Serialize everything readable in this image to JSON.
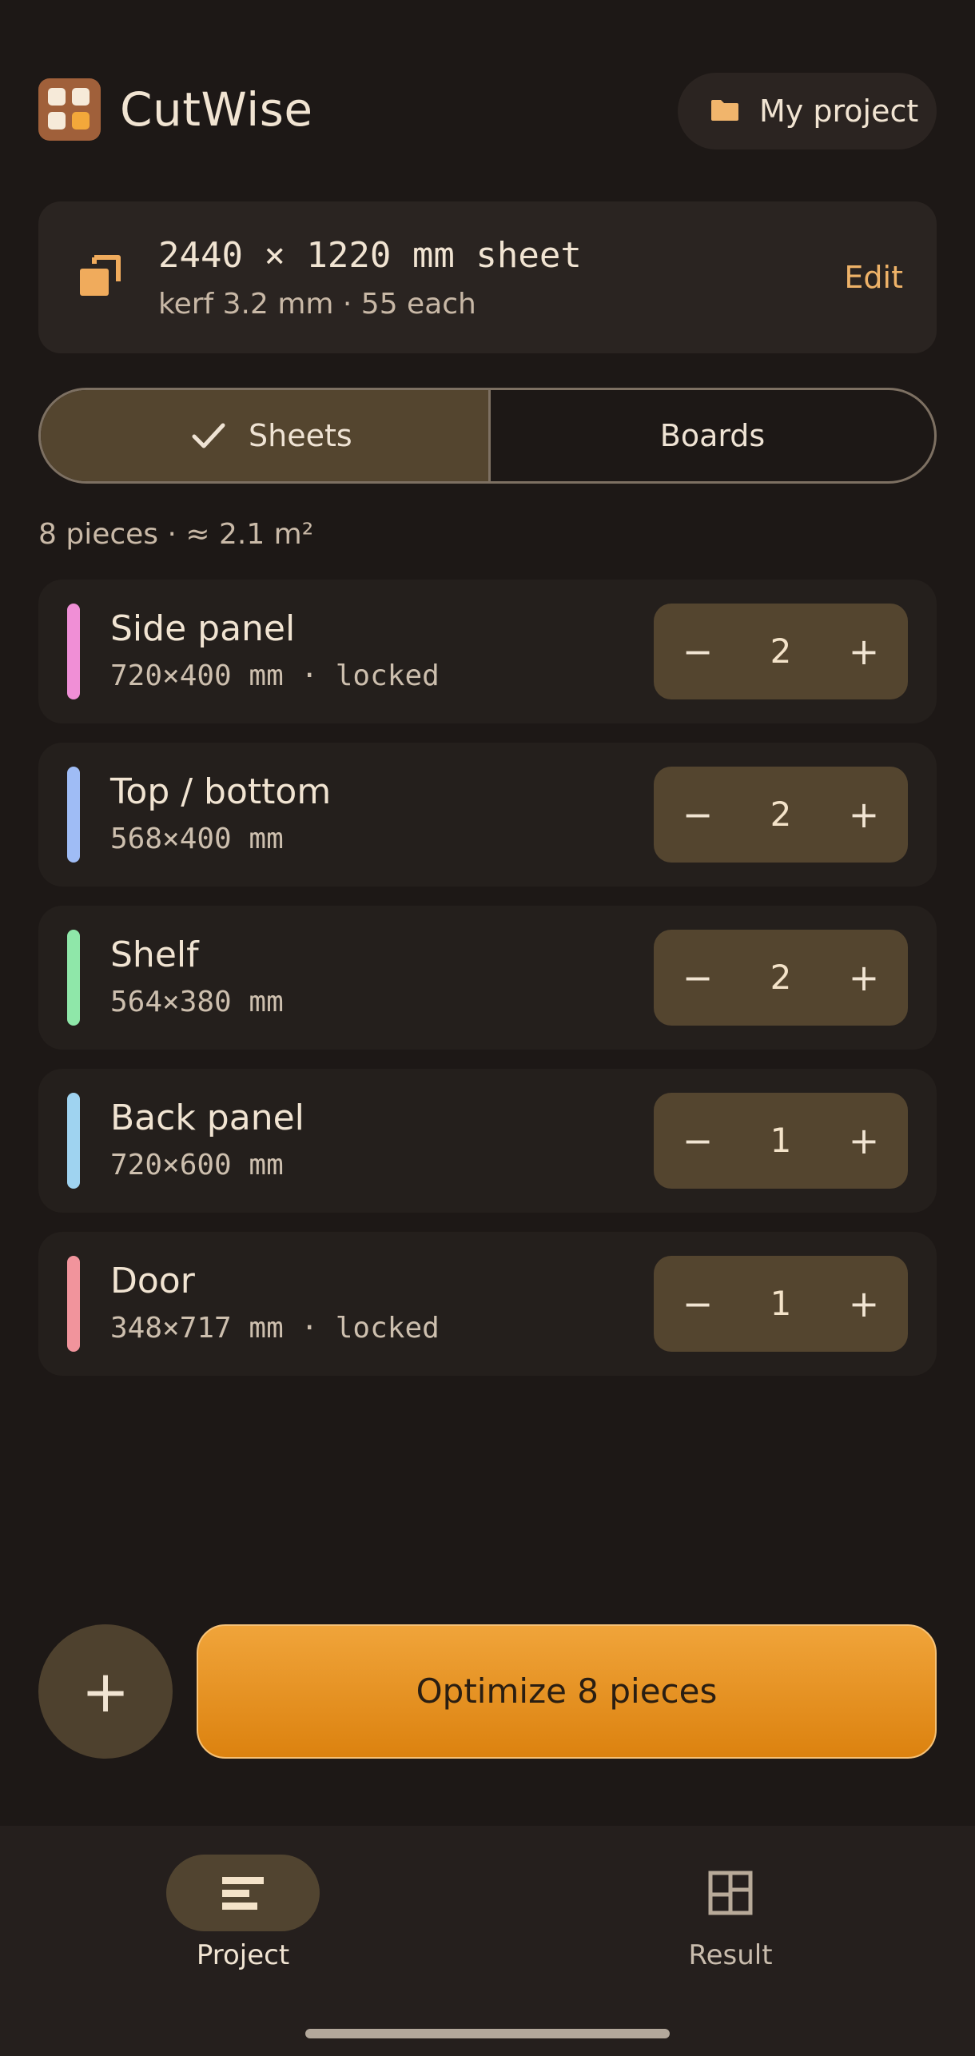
{
  "app": {
    "title": "CutWise",
    "project_button": "My project",
    "accent": "#f0a43a"
  },
  "sheet": {
    "title": "2440 × 1220 mm sheet",
    "subtitle": "kerf 3.2 mm  ·  55 each",
    "edit": "Edit",
    "icon": "copy-icon"
  },
  "mode": {
    "sheets": "Sheets",
    "boards": "Boards",
    "selected": "Sheets"
  },
  "summary": "8 pieces · ≈ 2.1 m²",
  "pieces": [
    {
      "name": "Side panel",
      "dims": "720×400 mm · locked",
      "qty": "2",
      "color": "#f08fd6"
    },
    {
      "name": "Top / bottom",
      "dims": "568×400 mm",
      "qty": "2",
      "color": "#9fbcf5"
    },
    {
      "name": "Shelf",
      "dims": "564×380 mm",
      "qty": "2",
      "color": "#8fe7a9"
    },
    {
      "name": "Back panel",
      "dims": "720×600 mm",
      "qty": "1",
      "color": "#9fd3f0"
    },
    {
      "name": "Door",
      "dims": "348×717 mm · locked",
      "qty": "1",
      "color": "#f1949c"
    }
  ],
  "stepper": {
    "minus": "−",
    "plus": "+"
  },
  "actions": {
    "add": "+",
    "optimize": "Optimize 8 pieces"
  },
  "nav": {
    "project": "Project",
    "result": "Result",
    "selected": "Project"
  }
}
